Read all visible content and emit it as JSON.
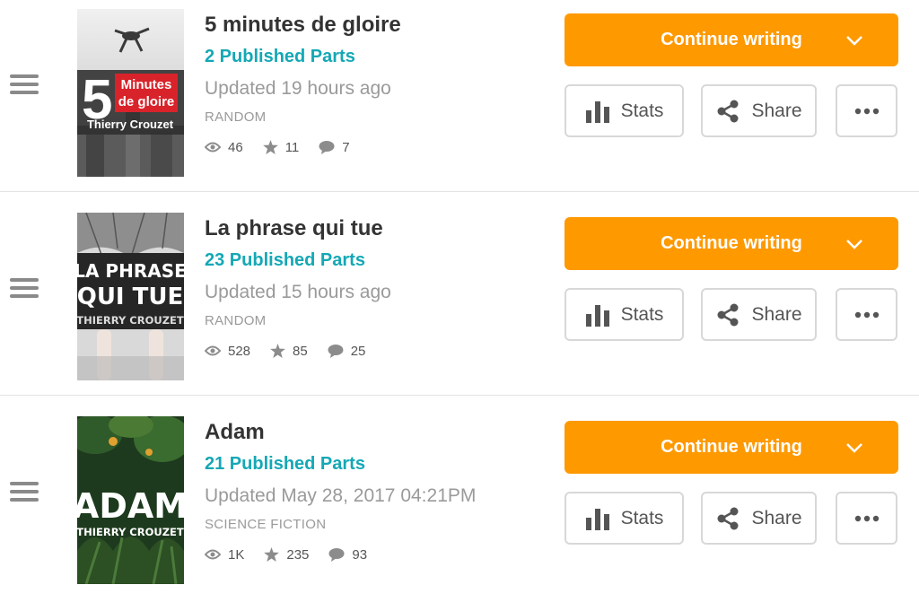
{
  "stories": [
    {
      "title": "5 minutes de gloire",
      "published_parts": "2 Published Parts",
      "updated": "Updated 19 hours ago",
      "category": "RANDOM",
      "views": "46",
      "votes": "11",
      "comments": "7",
      "cover": {
        "line1": "5",
        "line2": "Minutes",
        "line3": "de gloire",
        "author": "Thierry Crouzet"
      }
    },
    {
      "title": "La phrase qui tue",
      "published_parts": "23 Published Parts",
      "updated": "Updated 15 hours ago",
      "category": "RANDOM",
      "views": "528",
      "votes": "85",
      "comments": "25",
      "cover": {
        "line1": "LA PHRASE",
        "line2": "QUI TUE",
        "author": "THIERRY CROUZET"
      }
    },
    {
      "title": "Adam",
      "published_parts": "21 Published Parts",
      "updated": "Updated May 28, 2017 04:21PM",
      "category": "SCIENCE FICTION",
      "views": "1K",
      "votes": "235",
      "comments": "93",
      "cover": {
        "line1": "ADAM",
        "author": "THIERRY CROUZET"
      }
    }
  ],
  "actions": {
    "continue_label": "Continue writing",
    "stats_label": "Stats",
    "share_label": "Share"
  },
  "colors": {
    "accent_orange": "#ff9900",
    "parts_teal": "#14a8b5",
    "muted_text": "#9a9a9a"
  },
  "icons": {
    "drag": "drag-handle-icon",
    "cover": "book-cover-image",
    "views": "eye-icon",
    "votes": "star-icon",
    "comments": "comment-icon",
    "caret": "chevron-down-icon",
    "stats": "bar-chart-icon",
    "share": "share-icon",
    "more": "more-horizontal-icon"
  }
}
